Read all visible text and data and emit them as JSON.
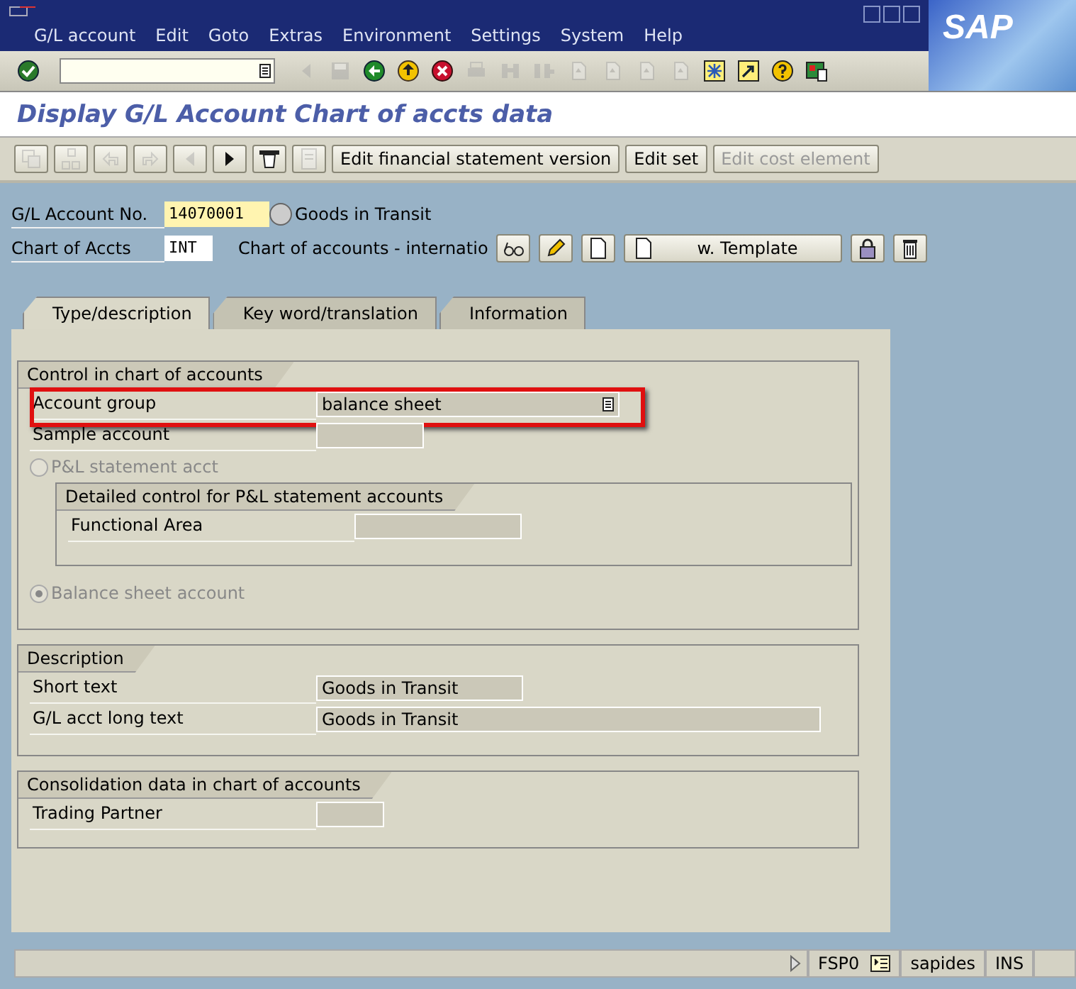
{
  "window": {
    "logo": "SAP"
  },
  "menu": [
    "G/L account",
    "Edit",
    "Goto",
    "Extras",
    "Environment",
    "Settings",
    "System",
    "Help"
  ],
  "standard_toolbar": [
    {
      "disabled": true
    },
    {
      "disabled": true
    },
    {
      "disabled": false
    },
    {
      "disabled": false
    },
    {
      "disabled": false
    },
    {
      "disabled": true
    },
    {
      "disabled": true
    },
    {
      "disabled": true
    },
    {
      "disabled": true
    },
    {
      "disabled": true
    },
    {
      "disabled": true
    },
    {
      "disabled": true
    },
    {
      "disabled": false
    },
    {
      "disabled": false
    },
    {
      "disabled": false
    },
    {
      "disabled": false
    }
  ],
  "title": "Display G/L Account Chart of accts data",
  "app_toolbar": [
    {
      "kind": "icon",
      "disabled": true
    },
    {
      "kind": "icon",
      "disabled": true
    },
    {
      "kind": "icon",
      "disabled": true
    },
    {
      "kind": "icon",
      "disabled": true
    },
    {
      "kind": "icon",
      "disabled": true
    },
    {
      "kind": "icon",
      "disabled": false
    },
    {
      "kind": "icon",
      "disabled": false
    },
    {
      "kind": "icon",
      "disabled": true
    },
    {
      "kind": "text",
      "label": "Edit financial statement version",
      "disabled": false
    },
    {
      "kind": "text",
      "label": "Edit set",
      "disabled": false
    },
    {
      "kind": "text",
      "label": "Edit cost element",
      "disabled": true
    }
  ],
  "header": {
    "account_no": {
      "label": "G/L Account No.",
      "value": "14070001",
      "description": "Goods in Transit"
    },
    "chart": {
      "label": "Chart of Accts",
      "value": "INT",
      "description": "Chart of accounts - internatio"
    },
    "template_button": {
      "label": "w. Template"
    }
  },
  "tabs": [
    {
      "label": "Type/description",
      "selected": true
    },
    {
      "label": "Key word/translation",
      "selected": false
    },
    {
      "label": "Information",
      "selected": false
    }
  ],
  "control_group": {
    "title": "Control in chart of accounts",
    "account_group": {
      "label": "Account group",
      "value": "balance sheet",
      "highlighted": true
    },
    "sample_account": {
      "label": "Sample account"
    },
    "pl_radio": {
      "label": "P&L statement acct",
      "selected": false,
      "disabled": true
    },
    "detail_group": {
      "title": "Detailed control for P&L statement accounts",
      "functional_area": {
        "label": "Functional Area"
      }
    },
    "bs_radio": {
      "label": "Balance sheet account",
      "selected": true,
      "disabled": true
    }
  },
  "description_group": {
    "title": "Description",
    "short_text": {
      "label": "Short text",
      "value": "Goods in Transit"
    },
    "long_text": {
      "label": "G/L acct long text",
      "value": "Goods in Transit"
    }
  },
  "consolidation_group": {
    "title": "Consolidation data in chart of accounts",
    "trading_partner": {
      "label": "Trading Partner"
    }
  },
  "status_bar": {
    "system": "FSP0",
    "server": "sapides",
    "mode": "INS"
  }
}
